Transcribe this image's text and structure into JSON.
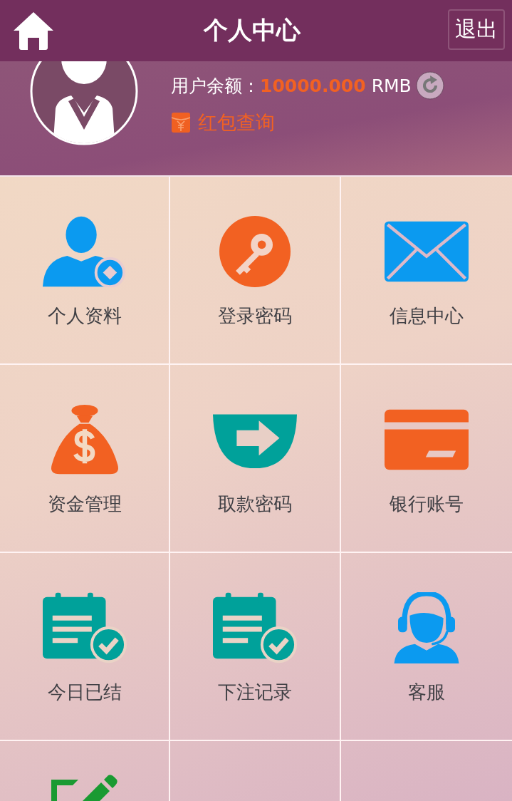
{
  "header": {
    "title": "个人中心",
    "logout_button": "退出"
  },
  "account": {
    "balance_label": "用户余额：",
    "balance_amount": "10000.000",
    "currency": "RMB",
    "red_packet_link": "红包查询"
  },
  "menu": {
    "items": [
      {
        "kind": "tile",
        "label": "个人资料"
      },
      {
        "kind": "tile",
        "label": "登录密码"
      },
      {
        "kind": "tile",
        "label": "信息中心"
      },
      {
        "kind": "tile",
        "label": "资金管理"
      },
      {
        "kind": "tile",
        "label": "取款密码"
      },
      {
        "kind": "tile",
        "label": "银行账号"
      },
      {
        "kind": "tile",
        "label": "今日已结"
      },
      {
        "kind": "tile",
        "label": "下注记录"
      },
      {
        "kind": "tile",
        "label": "客服"
      },
      {
        "kind": "cut"
      },
      {
        "kind": "empty"
      },
      {
        "kind": "empty"
      }
    ]
  }
}
